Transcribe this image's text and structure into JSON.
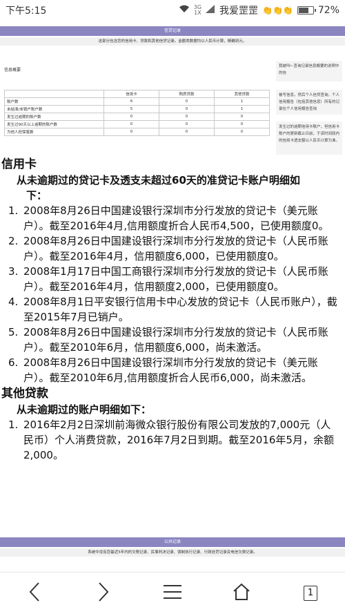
{
  "status_bar": {
    "time": "下午5:15",
    "network_3g": "3G",
    "network_1x": "1X",
    "carrier": "我爱罡罡",
    "emojis": "👏👏👏",
    "battery": "72%",
    "battery_level": 0.72
  },
  "report": {
    "section_header": "信贷记录",
    "section_subtitle": "这部分包含您的信用卡、贷款和其他信贷记录。金额类数据均以人民币计算，精确到元。",
    "info_title": "信息概要",
    "side_notes": [
      "我被叫ㄴ查询记录信息概要的说明中的信",
      "被写信息，然后个人信贷查询。个人信用报告（包括其他信息）所有的记录在个人信用报告查询",
      "发生过的逾期信用卡账户，但信用卡账户的更新截止日前，于该时间段内的信用卡透支额以人民币计算为准。"
    ],
    "table_headers": [
      "",
      "信用卡",
      "购房贷款",
      "其他贷款"
    ],
    "table_rows": [
      [
        "账户数",
        "6",
        "0",
        "1"
      ],
      [
        "未结清/未销户账户数",
        "5",
        "0",
        "1"
      ],
      [
        "发生过逾期的账户数",
        "0",
        "0",
        "0"
      ],
      [
        "发生过90天以上逾期的账户数",
        "0",
        "0",
        "0"
      ],
      [
        "为他人担保笔数",
        "0",
        "0",
        "0"
      ]
    ]
  },
  "credit_card": {
    "heading": "信用卡",
    "lead_line1": "从未逾期过的贷记卡及透支未超过60天的准贷记卡账户明细如",
    "lead_line2": "下：",
    "items": [
      {
        "num": "1.",
        "text": "2008年8月26日中国建设银行深圳市分行发放的贷记卡（美元账户）。截至2016年4月,信用额度折合人民币4,500，已使用额度0。"
      },
      {
        "num": "2.",
        "text": "2008年8月26日中国建设银行深圳市分行发放的贷记卡（人民币账户）。截至2016年4月，信用额度6,000，已使用额度0。"
      },
      {
        "num": "3.",
        "text": "2008年1月17日中国工商银行深圳市分行发放的贷记卡（人民币账户）。截至2016年4月，信用额度2,000，已使用额度0。"
      },
      {
        "num": "4.",
        "text": "2008年8月1日平安银行信用卡中心发放的贷记卡（人民币账户），截至2015年7月已销户。"
      },
      {
        "num": "5.",
        "text": "2008年8月26日中国建设银行深圳市分行发放的贷记卡（人民币账户）。截至2010年6月，信用额度6,000，尚未激活。"
      },
      {
        "num": "6.",
        "text": "2008年8月26日中国建设银行深圳市分行发放的贷记卡（美元账户）。截至2010年6月,信用额度折合人民币6,000，尚未激活。"
      }
    ]
  },
  "other_loans": {
    "heading": "其他贷款",
    "lead_line1": "从未逾期过的账户明细如下：",
    "items": [
      {
        "num": "1.",
        "text": "2016年2月2日深圳前海微众银行股份有限公司发放的7,000元（人民币）个人消费贷款，2016年7月2日到期。截至2016年5月，余额2,000。"
      }
    ]
  },
  "public_records": {
    "section_header": "公共记录",
    "section_subtitle": "系统中没有您最近5年内的欠税记录、民事判决记录、强制执行记录、行政处罚记录及电信欠费记录。"
  },
  "nav": {
    "back_icon": "chevron-left-icon",
    "forward_icon": "chevron-right-icon",
    "menu_icon": "menu-icon",
    "home_icon": "home-icon",
    "tab_count": "1"
  }
}
